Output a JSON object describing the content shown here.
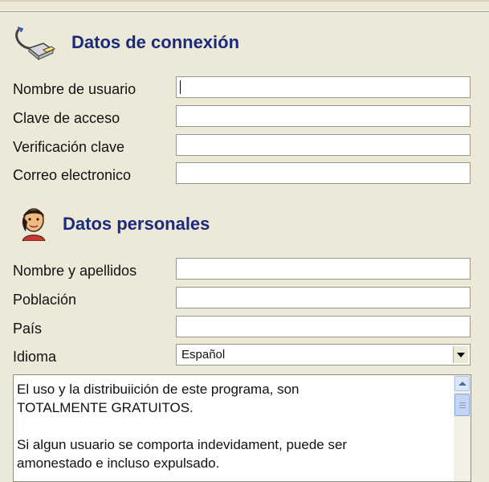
{
  "sections": {
    "connection": {
      "title": "Datos de connexión",
      "icon": "network-cable-icon",
      "fields": [
        {
          "label": "Nombre de usuario",
          "value": ""
        },
        {
          "label": "Clave de acceso",
          "value": ""
        },
        {
          "label": "Verificación clave",
          "value": ""
        },
        {
          "label": "Correo electronico",
          "value": ""
        }
      ]
    },
    "personal": {
      "title": "Datos personales",
      "icon": "person-icon",
      "fields": [
        {
          "label": "Nombre y apellidos",
          "value": ""
        },
        {
          "label": "Población",
          "value": ""
        },
        {
          "label": "País",
          "value": ""
        }
      ],
      "language": {
        "label": "Idioma",
        "selected": "Español"
      }
    }
  },
  "terms": {
    "line1": "El uso y la distribuiición de este programa, son",
    "line2": "TOTALMENTE GRATUITOS.",
    "line3": "Si algun usuario se comporta indevidament, puede ser",
    "line4": "amonestado e incluso expulsado."
  },
  "colors": {
    "title": "#1b2a7a",
    "background": "#ece9d8"
  }
}
